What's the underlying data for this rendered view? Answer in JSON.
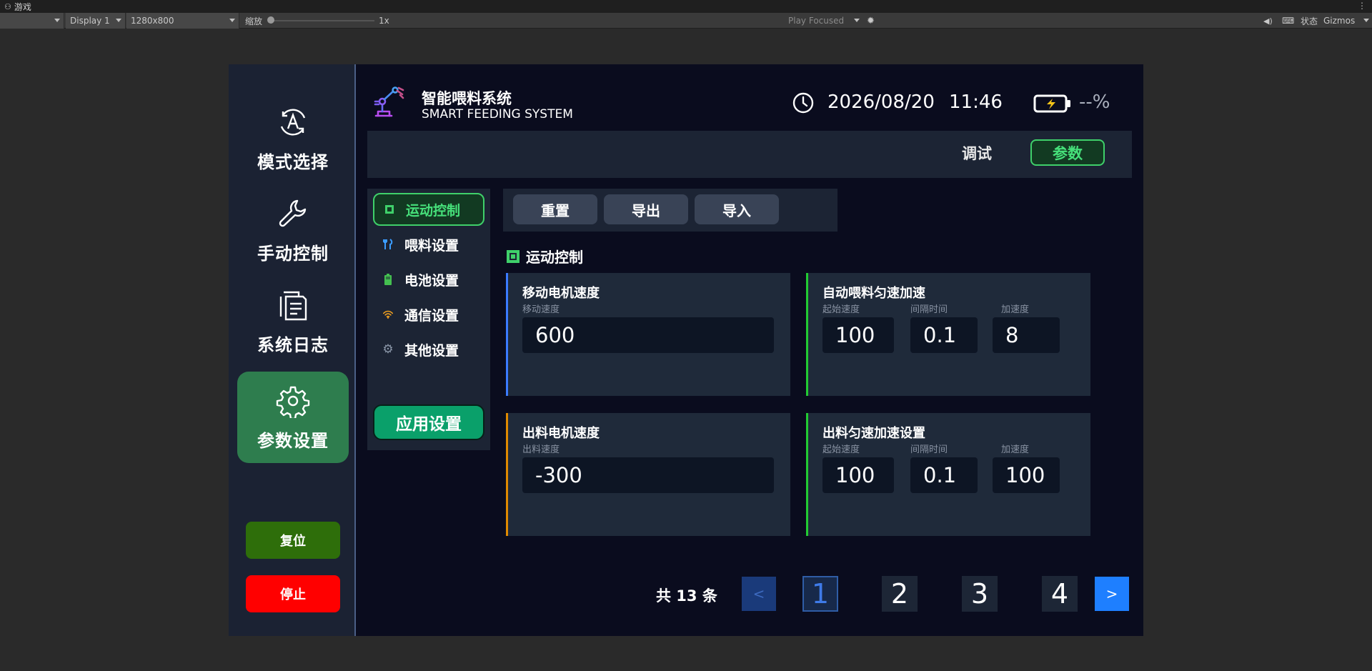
{
  "editor": {
    "tab_title": "游戏",
    "display": "Display 1",
    "resolution": "1280x800",
    "scale_label": "缩放",
    "scale_value": "1x",
    "play_mode": "Play Focused",
    "stats": "状态",
    "gizmos": "Gizmos"
  },
  "header": {
    "title_cn": "智能喂料系统",
    "title_en": "SMART FEEDING SYSTEM",
    "date": "2026/08/20",
    "time": "11:46",
    "battery_percent": "--%"
  },
  "sidebar": {
    "items": [
      {
        "label": "模式选择",
        "icon": "auto-mode-icon"
      },
      {
        "label": "手动控制",
        "icon": "wrench-icon"
      },
      {
        "label": "系统日志",
        "icon": "document-icon"
      },
      {
        "label": "参数设置",
        "icon": "gear-icon",
        "active": true
      }
    ],
    "reset_label": "复位",
    "stop_label": "停止"
  },
  "top_tabs": {
    "debug": "调试",
    "params": "参数"
  },
  "categories": {
    "items": [
      {
        "label": "运动控制",
        "icon": "chip-icon",
        "active": true
      },
      {
        "label": "喂料设置",
        "icon": "utensils-icon"
      },
      {
        "label": "电池设置",
        "icon": "battery-small-icon"
      },
      {
        "label": "通信设置",
        "icon": "wifi-icon"
      },
      {
        "label": "其他设置",
        "icon": "gear-small-icon"
      }
    ],
    "apply_label": "应用设置"
  },
  "actions": {
    "reset": "重置",
    "export": "导出",
    "import": "导入"
  },
  "section": {
    "title": "运动控制"
  },
  "cards": {
    "move_motor": {
      "title": "移动电机速度",
      "field_label": "移动速度",
      "value": "600",
      "accent": "#3b7bff"
    },
    "auto_feed": {
      "title": "自动喂料匀速加速",
      "labels": [
        "起始速度",
        "间隔时间",
        "加速度"
      ],
      "values": [
        "100",
        "0.1",
        "8"
      ],
      "accent": "#22cc33"
    },
    "discharge_motor": {
      "title": "出料电机速度",
      "field_label": "出料速度",
      "value": "-300",
      "accent": "#e08a00"
    },
    "discharge_accel": {
      "title": "出料匀速加速设置",
      "labels": [
        "起始速度",
        "间隔时间",
        "加速度"
      ],
      "values": [
        "100",
        "0.1",
        "100"
      ],
      "accent": "#22cc33"
    }
  },
  "pagination": {
    "total": "共 13 条",
    "prev": "<",
    "next": ">",
    "pages": [
      "1",
      "2",
      "3",
      "4"
    ],
    "current": "1"
  }
}
